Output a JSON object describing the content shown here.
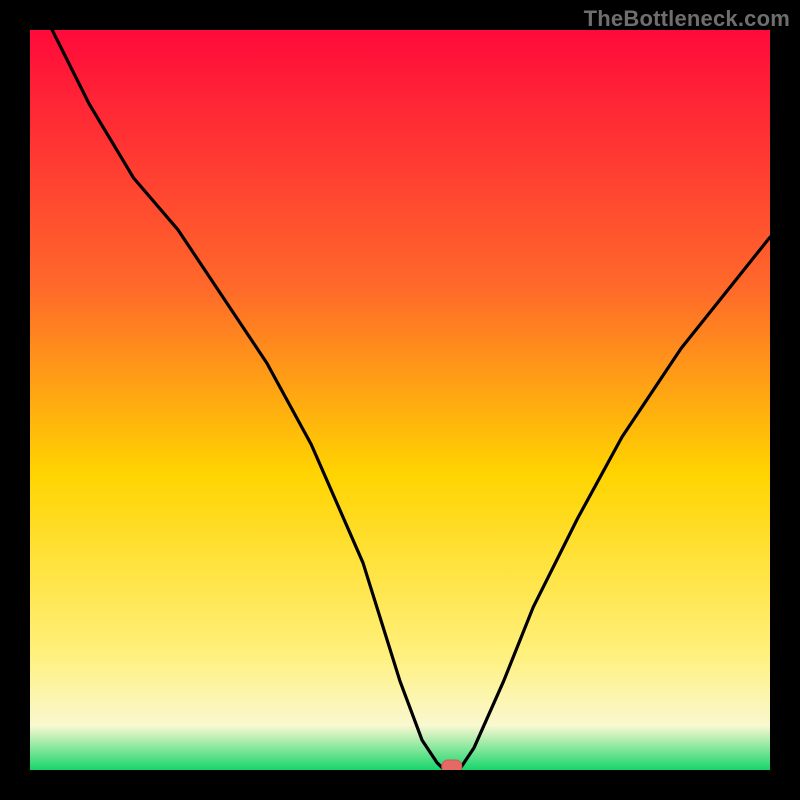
{
  "watermark": "TheBottleneck.com",
  "colors": {
    "gradient_top": "#ff0a3a",
    "gradient_mid_upper": "#ff6a2a",
    "gradient_mid": "#ffd400",
    "gradient_mid_lower": "#fff07a",
    "gradient_pale": "#faf8d0",
    "gradient_green": "#17d66b",
    "line": "#000000",
    "marker_fill": "#e46a63",
    "marker_stroke": "#d15a54",
    "frame": "#000000"
  },
  "chart_data": {
    "type": "line",
    "title": "",
    "xlabel": "",
    "ylabel": "",
    "xlim": [
      0,
      100
    ],
    "ylim": [
      0,
      100
    ],
    "x": [
      0,
      3,
      8,
      14,
      20,
      26,
      32,
      38,
      45,
      50,
      53,
      55,
      56,
      58,
      60,
      64,
      68,
      74,
      80,
      88,
      96,
      100
    ],
    "values": [
      118,
      100,
      90,
      80,
      73,
      64,
      55,
      44,
      28,
      12,
      4,
      1,
      0,
      0,
      3,
      12,
      22,
      34,
      45,
      57,
      67,
      72
    ],
    "marker": {
      "x": 57,
      "y": 0
    },
    "series": [
      {
        "name": "bottleneck-curve",
        "values": [
          118,
          100,
          90,
          80,
          73,
          64,
          55,
          44,
          28,
          12,
          4,
          1,
          0,
          0,
          3,
          12,
          22,
          34,
          45,
          57,
          67,
          72
        ]
      }
    ]
  }
}
